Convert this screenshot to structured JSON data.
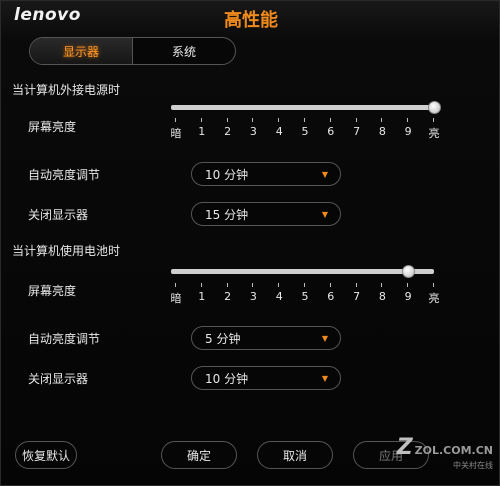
{
  "app": {
    "logo": "lenovo",
    "title": "高性能"
  },
  "tabs": [
    {
      "label": "显示器",
      "active": true
    },
    {
      "label": "系统",
      "active": false
    }
  ],
  "ac": {
    "heading": "当计算机外接电源时",
    "brightness_label": "屏幕亮度",
    "brightness_level": 10,
    "auto_brightness_label": "自动亮度调节",
    "auto_brightness_value": "10 分钟",
    "display_off_label": "关闭显示器",
    "display_off_value": "15 分钟"
  },
  "battery": {
    "heading": "当计算机使用电池时",
    "brightness_label": "屏幕亮度",
    "brightness_level": 9,
    "auto_brightness_label": "自动亮度调节",
    "auto_brightness_value": "5 分钟",
    "display_off_label": "关闭显示器",
    "display_off_value": "10 分钟"
  },
  "scale": [
    "暗",
    "1",
    "2",
    "3",
    "4",
    "5",
    "6",
    "7",
    "8",
    "9",
    "亮"
  ],
  "buttons": {
    "restore": "恢复默认",
    "ok": "确定",
    "cancel": "取消",
    "apply": "应用"
  },
  "watermark": {
    "main": "ZOL.COM.CN",
    "sub": "中关村在线"
  },
  "colors": {
    "accent": "#f08a1c",
    "background": "#050505",
    "border": "#555555"
  }
}
